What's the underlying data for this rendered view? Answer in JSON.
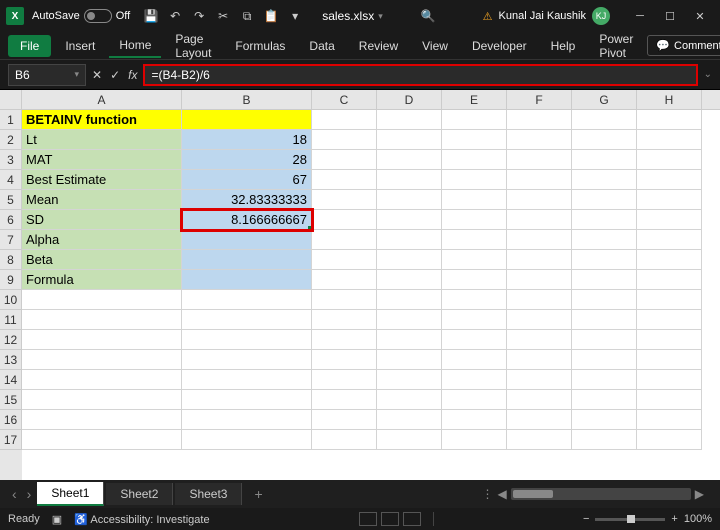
{
  "titlebar": {
    "autosave_label": "AutoSave",
    "autosave_state": "Off",
    "filename": "sales.xlsx",
    "user_name": "Kunal Jai Kaushik",
    "user_initials": "KJ"
  },
  "ribbon": {
    "tabs": [
      "File",
      "Insert",
      "Home",
      "Page Layout",
      "Formulas",
      "Data",
      "Review",
      "View",
      "Developer",
      "Help",
      "Power Pivot"
    ],
    "active_tab": "Home",
    "comments": "Comments"
  },
  "formula_bar": {
    "namebox": "B6",
    "formula": "=(B4-B2)/6"
  },
  "columns": [
    "A",
    "B",
    "C",
    "D",
    "E",
    "F",
    "G",
    "H"
  ],
  "row_numbers": [
    1,
    2,
    3,
    4,
    5,
    6,
    7,
    8,
    9,
    10,
    11,
    12,
    13,
    14,
    15,
    16,
    17
  ],
  "cells": {
    "a1": "BETAINV function",
    "a2": "Lt",
    "b2": "18",
    "a3": "MAT",
    "b3": "28",
    "a4": "Best Estimate",
    "b4": "67",
    "a5": "Mean",
    "b5": "32.83333333",
    "a6": "SD",
    "b6": "8.166666667",
    "a7": "Alpha",
    "a8": "Beta",
    "a9": "Formula"
  },
  "sheet_tabs": [
    "Sheet1",
    "Sheet2",
    "Sheet3"
  ],
  "active_sheet": "Sheet1",
  "statusbar": {
    "mode": "Ready",
    "accessibility": "Accessibility: Investigate",
    "zoom": "100%"
  }
}
